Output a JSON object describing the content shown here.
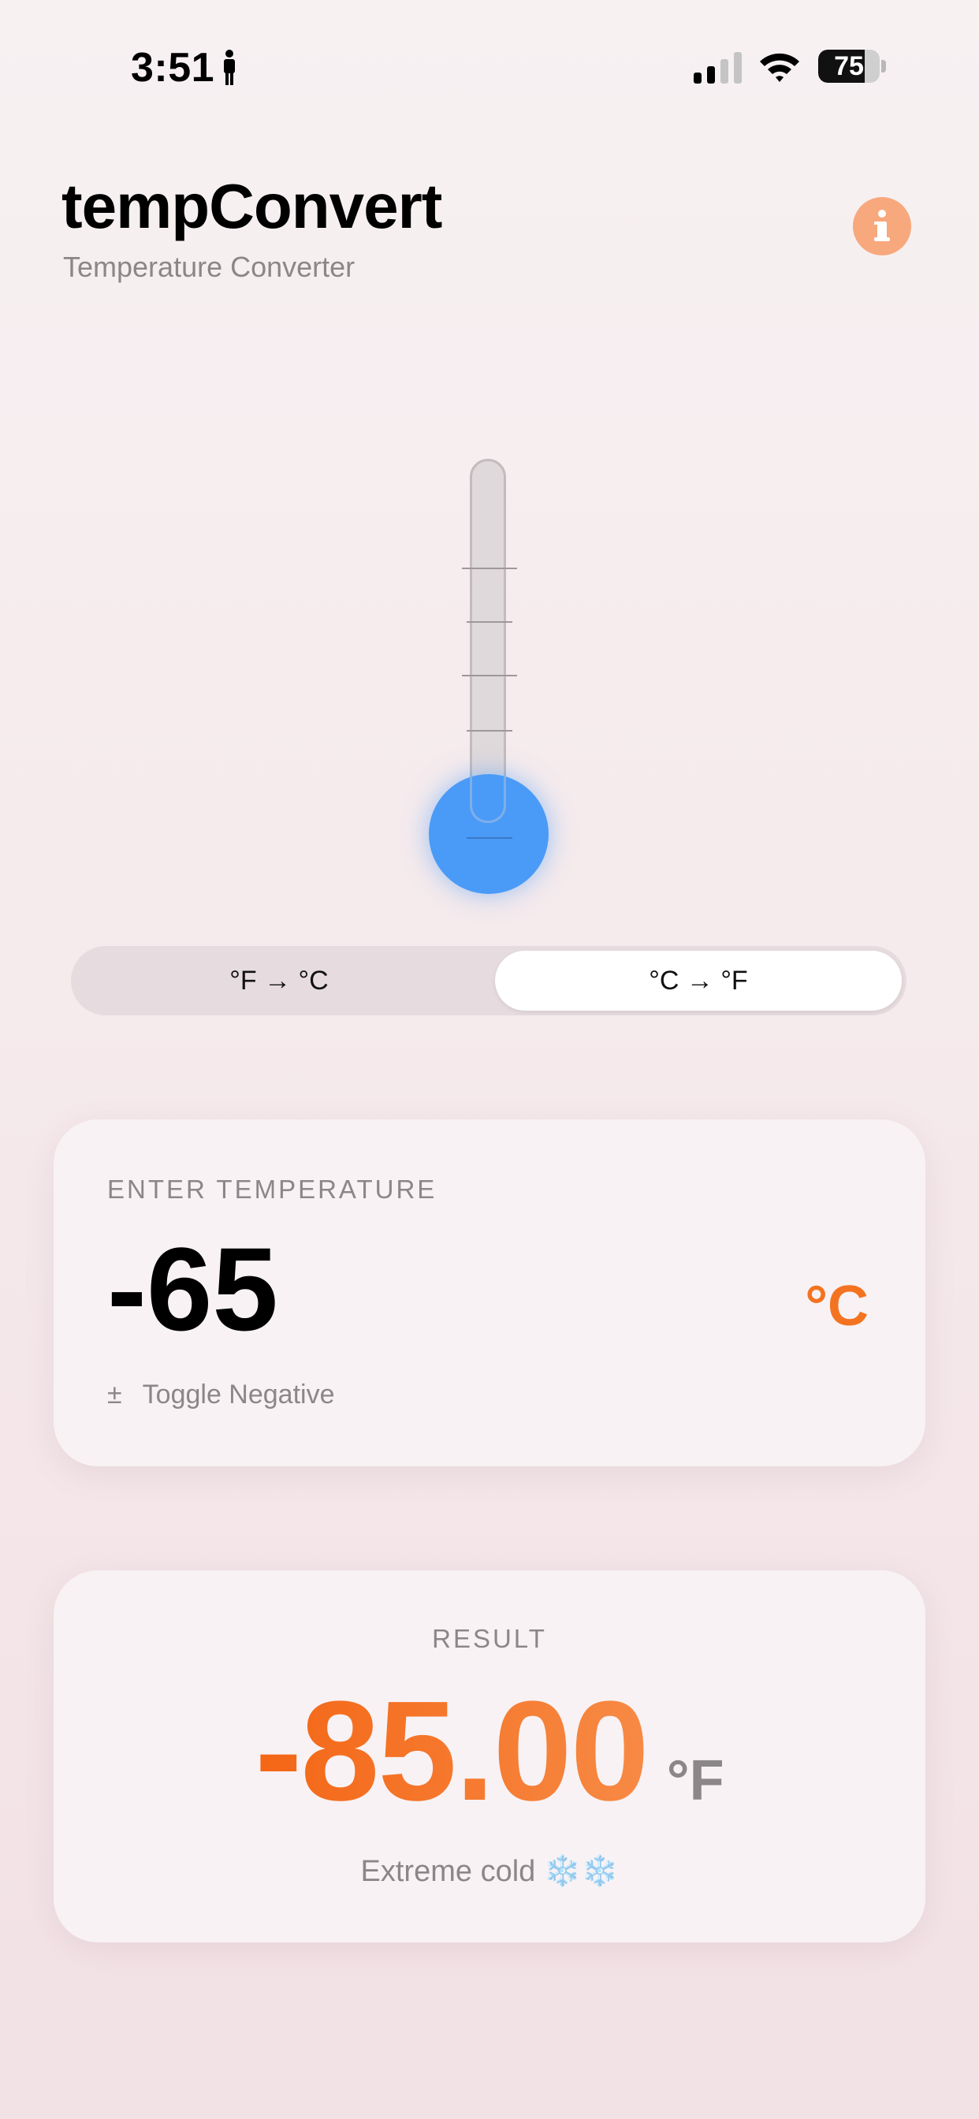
{
  "status_bar": {
    "time": "3:51",
    "battery_percent": "75",
    "battery_level": 0.75
  },
  "header": {
    "title": "tempConvert",
    "subtitle": "Temperature Converter",
    "info_icon": "info-icon"
  },
  "thermometer": {
    "level": 0.0
  },
  "mode_selector": {
    "options": [
      "°F → °C",
      "°C → °F"
    ],
    "selected": "°C → °F"
  },
  "input_card": {
    "label": "ENTER TEMPERATURE",
    "value": "-65",
    "unit": "°C",
    "toggle_label": "Toggle Negative",
    "toggle_icon": "±"
  },
  "result_card": {
    "label": "RESULT",
    "value": "-85.00",
    "unit": "°F",
    "description": "Extreme cold ❄️❄️"
  },
  "colors": {
    "accent": "#f46d1f",
    "info": "#f7a87c",
    "bulb": "#4a9bf7",
    "muted_text": "#8b8788"
  }
}
